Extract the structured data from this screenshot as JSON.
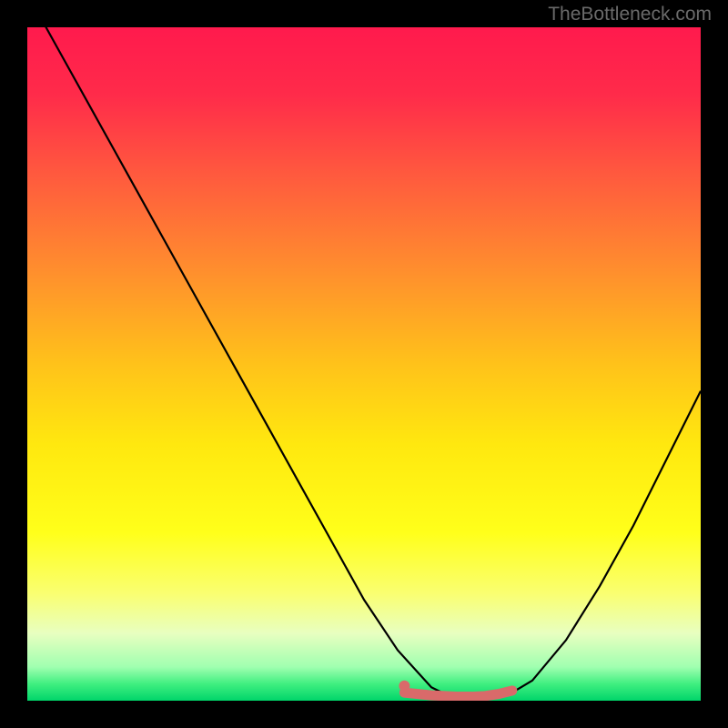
{
  "attribution": "TheBottleneck.com",
  "gradient": {
    "stops": [
      {
        "offset": 0.0,
        "color": "#ff1a4d"
      },
      {
        "offset": 0.1,
        "color": "#ff2b4a"
      },
      {
        "offset": 0.22,
        "color": "#ff5a3e"
      },
      {
        "offset": 0.35,
        "color": "#ff8a2f"
      },
      {
        "offset": 0.5,
        "color": "#ffc21a"
      },
      {
        "offset": 0.62,
        "color": "#ffe80f"
      },
      {
        "offset": 0.75,
        "color": "#ffff1a"
      },
      {
        "offset": 0.84,
        "color": "#faff70"
      },
      {
        "offset": 0.9,
        "color": "#e8ffc0"
      },
      {
        "offset": 0.95,
        "color": "#a0ffb0"
      },
      {
        "offset": 0.975,
        "color": "#40ef80"
      },
      {
        "offset": 1.0,
        "color": "#00d56a"
      }
    ]
  },
  "chart_data": {
    "type": "line",
    "title": "",
    "xlabel": "",
    "ylabel": "",
    "xlim": [
      0,
      100
    ],
    "ylim": [
      0,
      100
    ],
    "series": [
      {
        "name": "curve",
        "x": [
          0,
          5,
          10,
          15,
          20,
          25,
          30,
          35,
          40,
          45,
          50,
          55,
          60,
          62,
          65,
          70,
          72,
          75,
          80,
          85,
          90,
          95,
          100
        ],
        "y": [
          105,
          96,
          87,
          78,
          69,
          60,
          51,
          42,
          33,
          24,
          15,
          7.5,
          2.0,
          1.0,
          0.5,
          0.7,
          1.2,
          3.0,
          9.0,
          17,
          26,
          36,
          46
        ]
      },
      {
        "name": "marker-band",
        "x": [
          56,
          58,
          60,
          62,
          64,
          66,
          68,
          70,
          72
        ],
        "y": [
          1.2,
          1.0,
          0.8,
          0.7,
          0.6,
          0.6,
          0.7,
          1.0,
          1.5
        ]
      },
      {
        "name": "marker-dot",
        "x": [
          56
        ],
        "y": [
          2.2
        ]
      }
    ],
    "styles": {
      "curve": {
        "stroke": "#000000",
        "width": 2.2,
        "fill": "none"
      },
      "marker-band": {
        "stroke": "#d96a6a",
        "width": 11,
        "fill": "none",
        "linecap": "round"
      },
      "marker-dot": {
        "fill": "#d96a6a",
        "r": 6
      }
    }
  }
}
